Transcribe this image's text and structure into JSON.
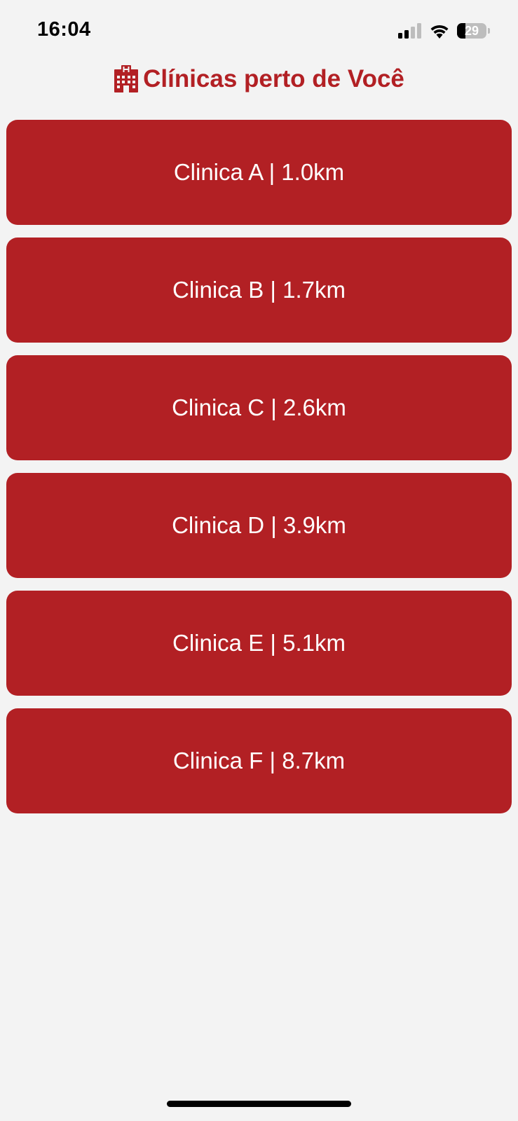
{
  "status_bar": {
    "time": "16:04",
    "battery_level": "29",
    "battery_fraction": 0.29,
    "signal_icon": "cellular-signal-icon",
    "wifi_icon": "wifi-icon",
    "battery_icon": "battery-icon"
  },
  "header": {
    "icon": "hospital-icon",
    "title": "Clínicas perto de Você"
  },
  "clinics": [
    {
      "label": "Clinica A | 1.0km"
    },
    {
      "label": "Clinica B | 1.7km"
    },
    {
      "label": "Clinica C | 2.6km"
    },
    {
      "label": "Clinica D | 3.9km"
    },
    {
      "label": "Clinica E | 5.1km"
    },
    {
      "label": "Clinica F | 8.7km"
    }
  ],
  "colors": {
    "accent": "#b22024",
    "background": "#f3f3f3",
    "button_text": "#ffffff"
  }
}
